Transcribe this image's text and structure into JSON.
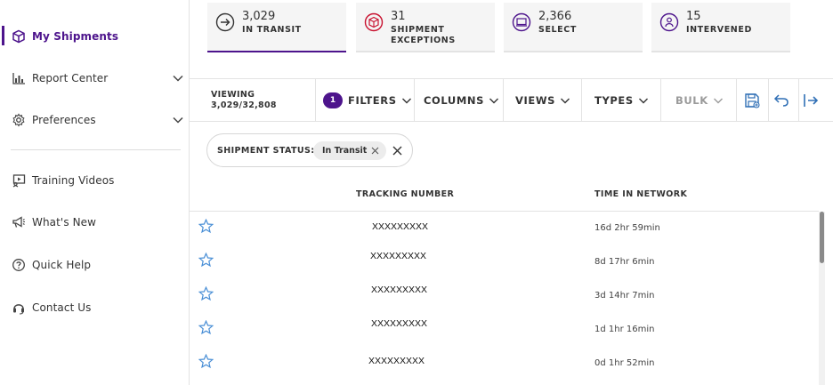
{
  "sidebar": {
    "items": [
      {
        "label": "My Shipments",
        "icon": "box-icon",
        "active": true
      },
      {
        "label": "Report Center",
        "icon": "bar-chart-icon",
        "expandable": true
      },
      {
        "label": "Preferences",
        "icon": "gear-icon",
        "expandable": true
      },
      {
        "label": "Training Videos",
        "icon": "video-icon"
      },
      {
        "label": "What's New",
        "icon": "megaphone-icon"
      },
      {
        "label": "Quick Help",
        "icon": "question-icon"
      },
      {
        "label": "Contact Us",
        "icon": "headset-icon"
      }
    ]
  },
  "cards": [
    {
      "number": "3,029",
      "caption_line1": "IN TRANSIT",
      "caption_line2": "",
      "icon": "arrow-circle-icon",
      "active": true
    },
    {
      "number": "31",
      "caption_line1": "SHIPMENT",
      "caption_line2": "EXCEPTIONS",
      "icon": "exception-box-icon"
    },
    {
      "number": "2,366",
      "caption_line1": "SELECT",
      "caption_line2": "",
      "icon": "monitor-icon"
    },
    {
      "number": "15",
      "caption_line1": "INTERVENED",
      "caption_line2": "",
      "icon": "person-circle-icon"
    }
  ],
  "toolbar": {
    "viewing_label": "VIEWING",
    "viewing_count": "3,029/32,808",
    "filter_count": "1",
    "filters_label": "FILTERS",
    "columns_label": "COLUMNS",
    "views_label": "VIEWS",
    "types_label": "TYPES",
    "bulk_label": "BULK"
  },
  "active_filter": {
    "label": "SHIPMENT STATUS:",
    "value": "In Transit"
  },
  "table": {
    "headers": {
      "tracking": "TRACKING NUMBER",
      "time": "TIME IN NETWORK"
    },
    "rows": [
      {
        "tracking": "XXXXXXXXX",
        "time": "16d 2hr 59min"
      },
      {
        "tracking": "XXXXXXXXX",
        "time": "8d 17hr 6min"
      },
      {
        "tracking": "XXXXXXXXX",
        "time": "3d 14hr 7min"
      },
      {
        "tracking": "XXXXXXXXX",
        "time": "1d 1hr 16min"
      },
      {
        "tracking": "XXXXXXXXX",
        "time": "0d 1hr 52min"
      }
    ]
  },
  "colors": {
    "brand_purple": "#4d148c",
    "exception_red": "#c8102e",
    "toolbar_icon_blue": "#2f6fb5",
    "star_blue": "#4a8fd6"
  }
}
